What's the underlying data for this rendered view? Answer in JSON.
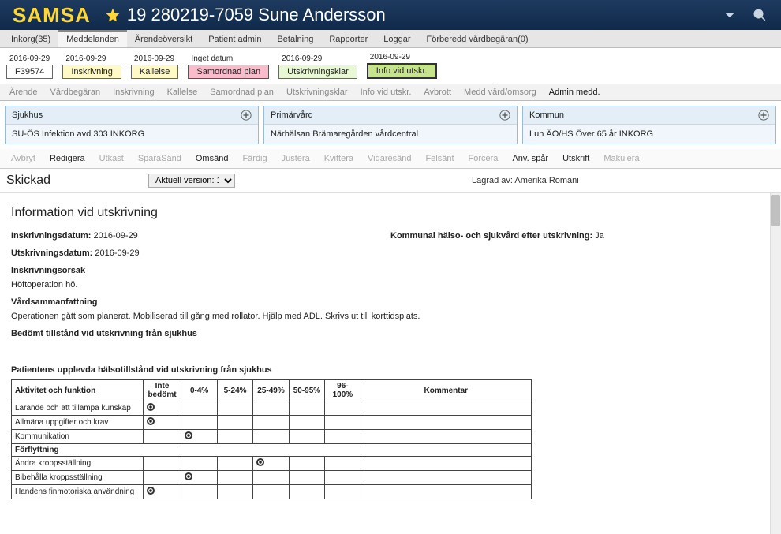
{
  "app": {
    "logo": "SAMSA"
  },
  "patient": {
    "title": "19 280219-7059 Sune Andersson"
  },
  "nav": {
    "items": [
      {
        "label": "Inkorg(35)",
        "active": false
      },
      {
        "label": "Meddelanden",
        "active": true
      },
      {
        "label": "Ärendeöversikt",
        "active": false
      },
      {
        "label": "Patient admin",
        "active": false
      },
      {
        "label": "Betalning",
        "active": false
      },
      {
        "label": "Rapporter",
        "active": false
      },
      {
        "label": "Loggar",
        "active": false
      },
      {
        "label": "Förberedd vårdbegäran(0)",
        "active": false
      }
    ]
  },
  "timeline": {
    "items": [
      {
        "date": "2016-09-29",
        "label": "F39574",
        "style": "tb-white"
      },
      {
        "date": "2016-09-29",
        "label": "Inskrivning",
        "style": "tb-yellow"
      },
      {
        "date": "2016-09-29",
        "label": "Kallelse",
        "style": "tb-yellow"
      },
      {
        "date": "Inget datum",
        "label": "Samordnad plan",
        "style": "tb-pink"
      },
      {
        "date": "2016-09-29",
        "label": "Utskrivningsklar",
        "style": "tb-lightgreen"
      },
      {
        "date": "2016-09-29",
        "label": "Info vid utskr.",
        "style": "tb-green"
      }
    ]
  },
  "subnav": {
    "items": [
      {
        "label": "Ärende",
        "active": false
      },
      {
        "label": "Vårdbegäran",
        "active": false
      },
      {
        "label": "Inskrivning",
        "active": false
      },
      {
        "label": "Kallelse",
        "active": false
      },
      {
        "label": "Samordnad plan",
        "active": false
      },
      {
        "label": "Utskrivningsklar",
        "active": false
      },
      {
        "label": "Info vid utskr.",
        "active": false
      },
      {
        "label": "Avbrott",
        "active": false
      },
      {
        "label": "Medd vård/omsorg",
        "active": false
      },
      {
        "label": "Admin medd.",
        "active": true
      }
    ]
  },
  "panels": [
    {
      "title": "Sjukhus",
      "body": "SU-ÖS Infektion avd 303 INKORG"
    },
    {
      "title": "Primärvård",
      "body": "Närhälsan Brämaregården vårdcentral"
    },
    {
      "title": "Kommun",
      "body": "Lun ÄO/HS Över 65 år INKORG"
    }
  ],
  "actions": [
    {
      "label": "Avbryt",
      "enabled": false
    },
    {
      "label": "Redigera",
      "enabled": true
    },
    {
      "label": "Utkast",
      "enabled": false
    },
    {
      "label": "SparaSänd",
      "enabled": false
    },
    {
      "label": "Omsänd",
      "enabled": true
    },
    {
      "label": "Färdig",
      "enabled": false
    },
    {
      "label": "Justera",
      "enabled": false
    },
    {
      "label": "Kvittera",
      "enabled": false
    },
    {
      "label": "Vidaresänd",
      "enabled": false
    },
    {
      "label": "Felsänt",
      "enabled": false
    },
    {
      "label": "Forcera",
      "enabled": false
    },
    {
      "label": "Anv. spår",
      "enabled": true
    },
    {
      "label": "Utskrift",
      "enabled": true
    },
    {
      "label": "Makulera",
      "enabled": false
    }
  ],
  "status": {
    "title": "Skickad",
    "version_label": "Aktuell version: 1",
    "saved_by_label": "Lagrad av: Amerika Romani"
  },
  "content": {
    "section_title": "Information vid utskrivning",
    "inskrivning_label": "Inskrivningsdatum:",
    "inskrivning_value": "2016-09-29",
    "utskrivning_label": "Utskrivningsdatum:",
    "utskrivning_value": "2016-09-29",
    "kommunal_label": "Kommunal hälso- och sjukvård efter utskrivning:",
    "kommunal_value": "Ja",
    "orsak_label": "Inskrivningsorsak",
    "orsak_text": "Höftoperation hö.",
    "vardsamman_label": "Vårdsammanfattning",
    "vardsamman_text": "Operationen gått som planerat. Mobiliserad till gång med rollator. Hjälp med ADL. Skrivs ut till korttidsplats.",
    "bedomt_label": "Bedömt tillstånd vid utskrivning från sjukhus",
    "patient_label": "Patientens upplevda hälsotillstånd vid utskrivning från sjukhus",
    "table": {
      "headers": [
        "Aktivitet och funktion",
        "Inte bedömt",
        "0-4%",
        "5-24%",
        "25-49%",
        "50-95%",
        "96-100%",
        "Kommentar"
      ],
      "rows": [
        {
          "label": "Lärande och att tillämpa kunskap",
          "indent": false,
          "group": false,
          "checked": 1
        },
        {
          "label": "Allmäna uppgifter och krav",
          "indent": false,
          "group": false,
          "checked": 1
        },
        {
          "label": "Kommunikation",
          "indent": false,
          "group": false,
          "checked": 2
        },
        {
          "label": "Förflyttning",
          "indent": false,
          "group": true,
          "checked": null
        },
        {
          "label": "Ändra kroppsställning",
          "indent": true,
          "group": false,
          "checked": 4
        },
        {
          "label": "Bibehålla kroppsställning",
          "indent": true,
          "group": false,
          "checked": 2
        },
        {
          "label": "Handens finmotoriska användning",
          "indent": true,
          "group": false,
          "checked": 1
        }
      ]
    }
  }
}
